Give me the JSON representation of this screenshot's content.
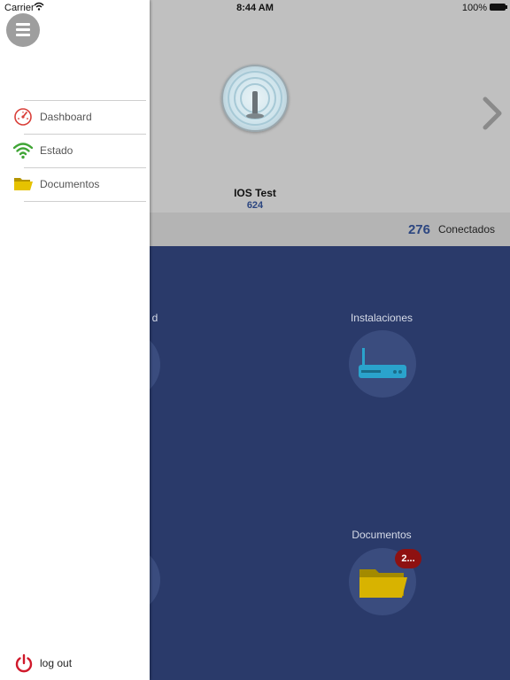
{
  "status_bar": {
    "carrier": "Carrier",
    "time": "8:44 AM",
    "battery": "100%"
  },
  "device": {
    "name": "IOS Test",
    "count": "624"
  },
  "connected": {
    "count": "276",
    "label": "Conectados"
  },
  "tiles": {
    "left_partial_label": "d",
    "instalaciones_label": "Instalaciones",
    "documentos_label": "Documentos",
    "documentos_badge": "2..."
  },
  "drawer": {
    "items": [
      {
        "label": "Dashboard",
        "icon": "dashboard-gauge-icon",
        "color": "#d9403a"
      },
      {
        "label": "Estado",
        "icon": "wifi-icon",
        "color": "#3fa535"
      },
      {
        "label": "Documentos",
        "icon": "folder-icon",
        "color": "#d8b300"
      }
    ],
    "logout_label": "log out",
    "logout_color": "#d0192b"
  },
  "colors": {
    "primary_blue": "#2a3a6a",
    "top_panel": "#c0c0c0",
    "connected_bar": "#b4b4b4",
    "badge": "#8e1111"
  }
}
